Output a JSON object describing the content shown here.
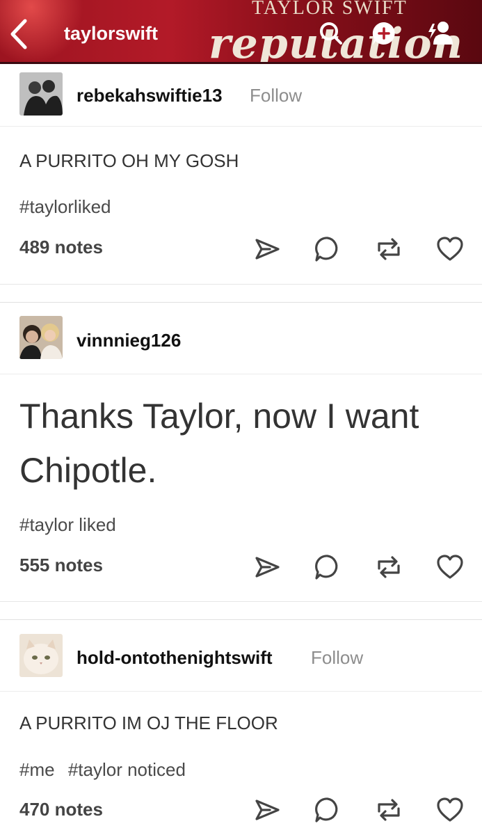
{
  "header": {
    "title": "taylorswift",
    "brand_top": "TAYLOR SWIFT",
    "brand_main": "reputation",
    "icons": [
      "chevron-left-icon",
      "search-icon",
      "new-post-icon",
      "person-add-icon"
    ]
  },
  "posts": [
    {
      "username": "rebekahswiftie13",
      "follow_label": "Follow",
      "body": "A PURRITO OH MY GOSH",
      "tags": [
        "#taylorliked"
      ],
      "notes": "489 notes"
    },
    {
      "username": "vinnnieg126",
      "body": "Thanks Taylor, now I want Chipotle.",
      "tags": [
        "#taylor liked"
      ],
      "notes": "555 notes"
    },
    {
      "username": "hold-ontothenightswift",
      "follow_label": "Follow",
      "body": "A PURRITO IM OJ THE FLOOR",
      "tags": [
        "#me",
        "#taylor noticed"
      ],
      "notes": "470 notes"
    }
  ],
  "actions": [
    "share-icon",
    "comment-icon",
    "reblog-icon",
    "heart-icon"
  ],
  "colors": {
    "header_red": "#b31a28",
    "text": "#333333",
    "muted": "#8d8d8d"
  }
}
